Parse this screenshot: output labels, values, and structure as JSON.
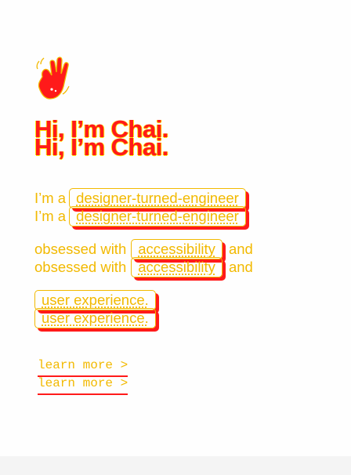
{
  "hero": {
    "heading": "Hi, I’m Chai.",
    "intro_prefix": "I’m a",
    "role": "designer-turned-engineer",
    "obsessed_prefix": "obsessed with",
    "focus_1": "accessibility",
    "conjunction": "and",
    "focus_2": "user experience.",
    "cta_label": "learn more >"
  },
  "logo": {
    "icon": "waving-hands-icon"
  },
  "colors": {
    "accent_red": "#ff1a1a",
    "accent_yellow": "#f2b900",
    "background": "#fefefe"
  }
}
